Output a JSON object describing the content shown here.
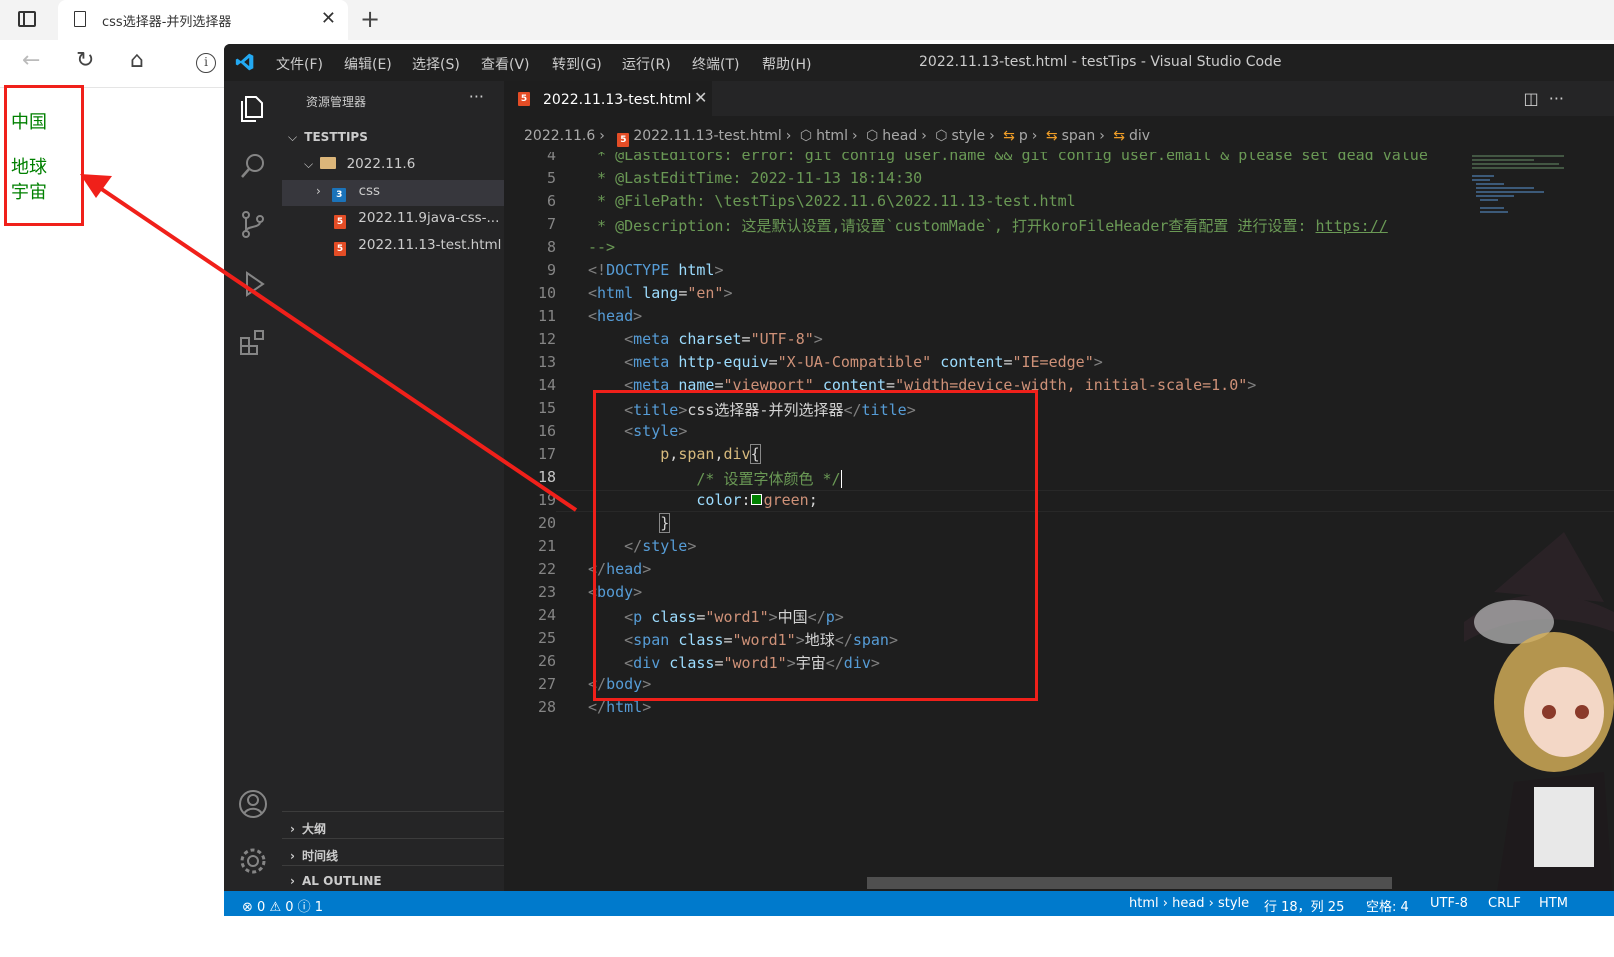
{
  "browser": {
    "tab_title": "css选择器-并列选择器",
    "tab_close": "✕",
    "new_tab": "+",
    "back": "←",
    "refresh": "↻",
    "home": "⌂",
    "info": "i"
  },
  "page": {
    "words": [
      "中国",
      "地球",
      "宇宙"
    ],
    "text_color": "#008000"
  },
  "vscode": {
    "menu": [
      "文件(F)",
      "编辑(E)",
      "选择(S)",
      "查看(V)",
      "转到(G)",
      "运行(R)",
      "终端(T)",
      "帮助(H)"
    ],
    "window_title": "2022.11.13-test.html - testTips - Visual Studio Code",
    "explorer_title": "资源管理器",
    "explorer_more": "···",
    "workspace": "TESTTIPS",
    "tree": {
      "folder": "2022.11.6",
      "subfolder": "css",
      "file1": "2022.11.9java-css-...",
      "file2": "2022.11.13-test.html"
    },
    "panels": [
      "大纲",
      "时间线",
      "AL OUTLINE"
    ],
    "editor_tab": "2022.11.13-test.html",
    "editor_tab_close": "✕",
    "breadcrumb": [
      "2022.11.6",
      "2022.11.13-test.html",
      "html",
      "head",
      "style",
      "p",
      "span",
      "div"
    ],
    "line_numbers": [
      "4",
      "5",
      "6",
      "7",
      "8",
      "9",
      "10",
      "11",
      "12",
      "13",
      "14",
      "15",
      "16",
      "17",
      "18",
      "19",
      "20",
      "21",
      "22",
      "23",
      "24",
      "25",
      "26",
      "27",
      "28"
    ],
    "status": {
      "errors": "0",
      "warnings": "0",
      "info": "1",
      "path": "html › head › style",
      "position": "行 18，列 25",
      "spaces": "空格: 4",
      "encoding": "UTF-8",
      "eol": "CRLF",
      "language": "HTM"
    },
    "accent": "#007acc"
  }
}
